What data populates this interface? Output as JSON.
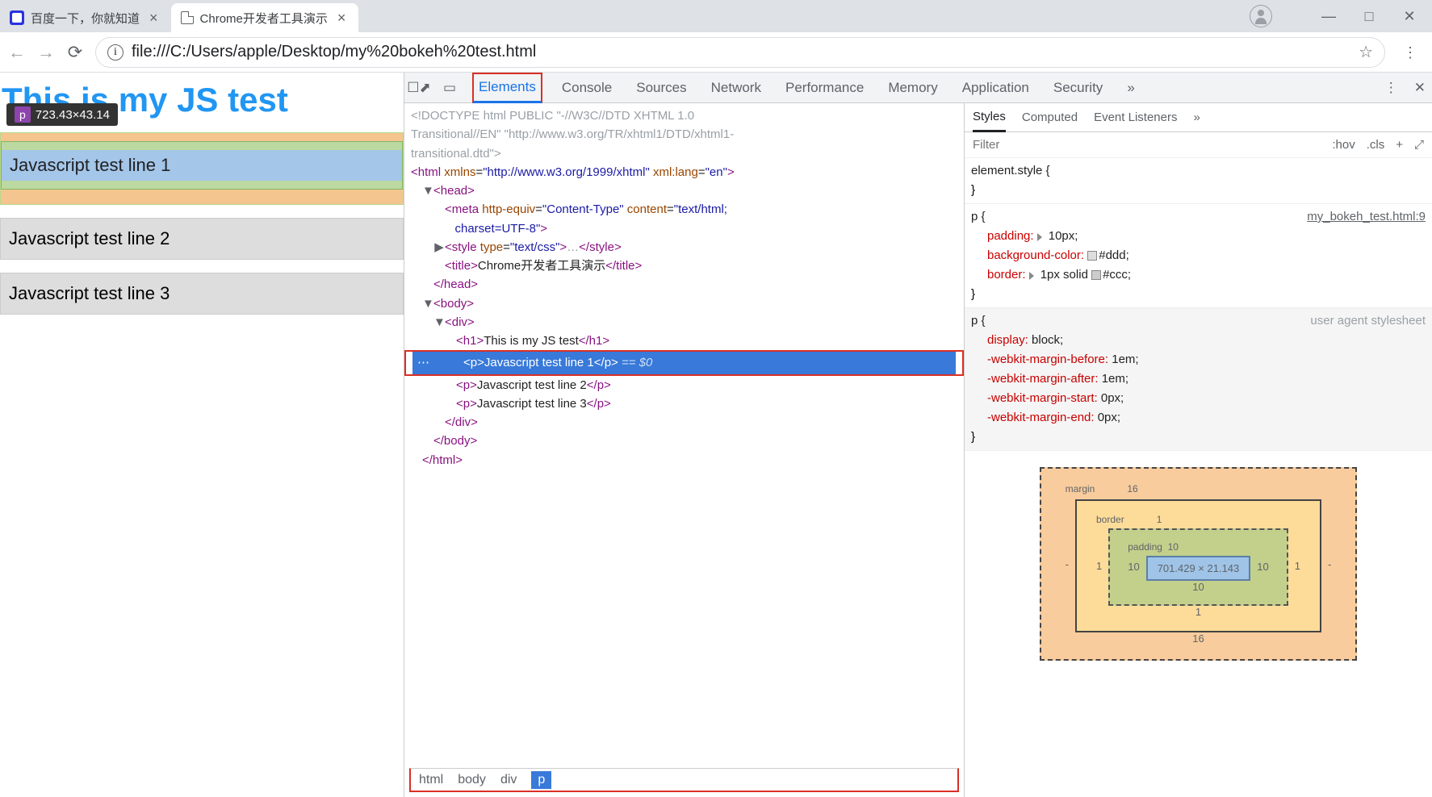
{
  "tabs": {
    "baidu": "百度一下，你就知道",
    "active": "Chrome开发者工具演示"
  },
  "url": "file:///C:/Users/apple/Desktop/my%20bokeh%20test.html",
  "page": {
    "h1": "This is my JS test",
    "tooltip_tag": "p",
    "tooltip_dims": "723.43×43.14",
    "line1": "Javascript test line 1",
    "line2": "Javascript test line 2",
    "line3": "Javascript test line 3"
  },
  "devtools": {
    "tabs": [
      "Elements",
      "Console",
      "Sources",
      "Network",
      "Performance",
      "Memory",
      "Application",
      "Security"
    ],
    "styles_tabs": [
      "Styles",
      "Computed",
      "Event Listeners"
    ],
    "filter_placeholder": "Filter",
    "hov": ":hov",
    "cls": ".cls"
  },
  "dom": {
    "doctype": "<!DOCTYPE html PUBLIC \"-//W3C//DTD XHTML 1.0 Transitional//EN\" \"http://www.w3.org/TR/xhtml1/DTD/xhtml1-transitional.dtd\">",
    "html_attr": "xmlns=\"http://www.w3.org/1999/xhtml\" xml:lang=\"en\"",
    "meta": "http-equiv=\"Content-Type\" content=\"text/html; charset=UTF-8\"",
    "style_attr": "type=\"text/css\"",
    "title": "Chrome开发者工具演示",
    "h1": "This is my JS test",
    "p1": "Javascript test line 1",
    "p2": "Javascript test line 2",
    "p3": "Javascript test line 3",
    "selector_suffix": "== $0",
    "crumbs": [
      "html",
      "body",
      "div",
      "p"
    ]
  },
  "styles": {
    "elstyle": "element.style {",
    "rule_p_sel": "p {",
    "rule_p_link": "my_bokeh_test.html:9",
    "padding": "padding:",
    "padding_v": "10px;",
    "bg": "background-color:",
    "bg_v": "#ddd;",
    "border": "border:",
    "border_v": "1px solid ",
    "border_c": "#ccc;",
    "ua_label": "user agent stylesheet",
    "display": "display:",
    "display_v": "block;",
    "wmb": "-webkit-margin-before:",
    "wmb_v": "1em;",
    "wma": "-webkit-margin-after:",
    "wma_v": "1em;",
    "wms": "-webkit-margin-start:",
    "wms_v": "0px;",
    "wme": "-webkit-margin-end:",
    "wme_v": "0px;"
  },
  "boxmodel": {
    "margin": "margin",
    "margin_v": "16",
    "border": "border",
    "border_v": "1",
    "padding": "padding",
    "padding_v": "10",
    "dash": "-",
    "content": "701.429 × 21.143"
  }
}
